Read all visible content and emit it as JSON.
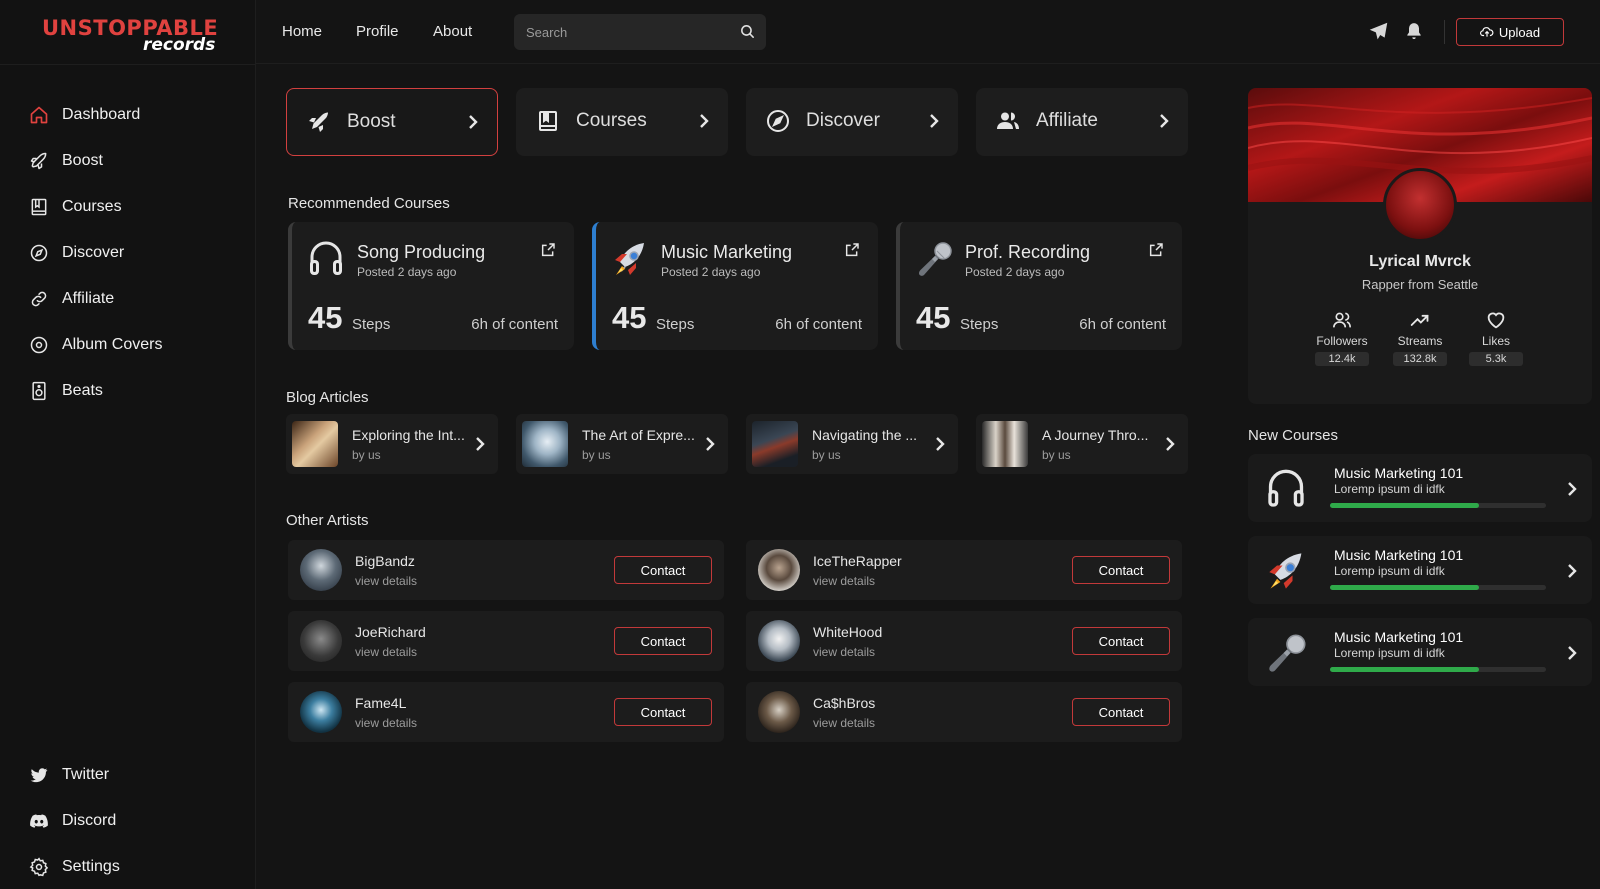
{
  "brand": {
    "main": "UNSTOPPABLE",
    "sub": "records"
  },
  "sidebar": {
    "items": [
      {
        "label": "Dashboard",
        "icon": "home-icon",
        "active": true
      },
      {
        "label": "Boost",
        "icon": "rocket-icon"
      },
      {
        "label": "Courses",
        "icon": "book-icon"
      },
      {
        "label": "Discover",
        "icon": "compass-icon"
      },
      {
        "label": "Affiliate",
        "icon": "link-icon"
      },
      {
        "label": "Album Covers",
        "icon": "disc-icon"
      },
      {
        "label": "Beats",
        "icon": "speaker-icon"
      }
    ],
    "bottom": [
      {
        "label": "Twitter",
        "icon": "twitter-icon"
      },
      {
        "label": "Discord",
        "icon": "discord-icon"
      },
      {
        "label": "Settings",
        "icon": "gear-icon"
      }
    ]
  },
  "topbar": {
    "links": [
      "Home",
      "Profile",
      "About"
    ],
    "search_placeholder": "Search",
    "upload_label": "Upload"
  },
  "quick_links": [
    {
      "label": "Boost",
      "icon": "rocket-icon",
      "active": true
    },
    {
      "label": "Courses",
      "icon": "book-icon"
    },
    {
      "label": "Discover",
      "icon": "compass-icon"
    },
    {
      "label": "Affiliate",
      "icon": "users-icon"
    }
  ],
  "recommended": {
    "title": "Recommended Courses",
    "courses": [
      {
        "title": "Song Producing",
        "posted": "Posted 2 days ago",
        "steps": "45",
        "steps_label": "Steps",
        "content": "6h of content",
        "icon": "headphones-icon"
      },
      {
        "title": "Music Marketing",
        "posted": "Posted 2 days ago",
        "steps": "45",
        "steps_label": "Steps",
        "content": "6h of content",
        "icon": "rocket-emoji-icon"
      },
      {
        "title": "Prof. Recording",
        "posted": "Posted 2 days ago",
        "steps": "45",
        "steps_label": "Steps",
        "content": "6h of content",
        "icon": "microphone-icon"
      }
    ]
  },
  "blog": {
    "title": "Blog Articles",
    "articles": [
      {
        "title": "Exploring the Int...",
        "by": "by us"
      },
      {
        "title": "The Art of Expre...",
        "by": "by us"
      },
      {
        "title": "Navigating the ...",
        "by": "by us"
      },
      {
        "title": "A Journey Thro...",
        "by": "by us"
      }
    ]
  },
  "artists": {
    "title": "Other Artists",
    "details_label": "view details",
    "contact_label": "Contact",
    "list": [
      {
        "name": "BigBandz"
      },
      {
        "name": "IceTheRapper"
      },
      {
        "name": "JoeRichard"
      },
      {
        "name": "WhiteHood"
      },
      {
        "name": "Fame4L"
      },
      {
        "name": "Ca$hBros"
      }
    ]
  },
  "profile": {
    "name": "Lyrical Mvrck",
    "description": "Rapper from Seattle",
    "stats": [
      {
        "label": "Followers",
        "value": "12.4k",
        "icon": "users-icon"
      },
      {
        "label": "Streams",
        "value": "132.8k",
        "icon": "trending-up-icon"
      },
      {
        "label": "Likes",
        "value": "5.3k",
        "icon": "heart-icon"
      }
    ]
  },
  "new_courses": {
    "title": "New Courses",
    "list": [
      {
        "title": "Music Marketing 101",
        "subtitle": "Loremp ipsum di idfk",
        "progress": 0.69,
        "icon": "headphones-icon"
      },
      {
        "title": "Music Marketing 101",
        "subtitle": "Loremp ipsum di idfk",
        "progress": 0.69,
        "icon": "rocket-emoji-icon"
      },
      {
        "title": "Music Marketing 101",
        "subtitle": "Loremp ipsum di idfk",
        "progress": 0.69,
        "icon": "microphone-icon"
      }
    ]
  },
  "colors": {
    "accent": "#d2403f",
    "progress": "#2faa4a",
    "blue_accent": "#2e7fd0"
  }
}
